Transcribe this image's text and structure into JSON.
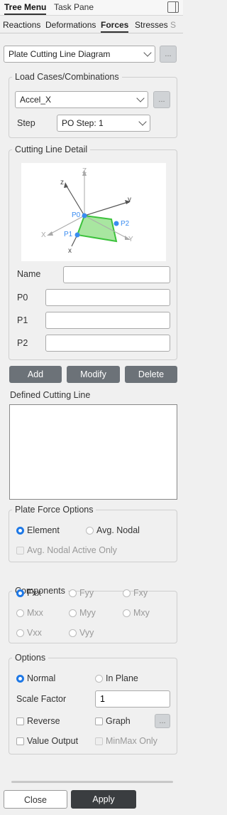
{
  "top_tabs": [
    "Tree Menu",
    "Task Pane"
  ],
  "sub_tabs": [
    "Reactions",
    "Deformations",
    "Forces",
    "Stresses",
    "S"
  ],
  "diagram_select": "Plate Cutting Line Diagram",
  "dots_label": "...",
  "load_cases": {
    "legend": "Load Cases/Combinations",
    "selected": "Accel_X",
    "step_label": "Step",
    "step_value": "PO Step: 1"
  },
  "cutting_line": {
    "legend": "Cutting Line Detail",
    "figure_labels": {
      "Z": "Z",
      "z": "z",
      "y": "y",
      "X": "X",
      "x": "x",
      "Y": "Y",
      "P0": "P0",
      "P1": "P1",
      "P2": "P2"
    },
    "name_label": "Name",
    "p0_label": "P0",
    "p1_label": "P1",
    "p2_label": "P2",
    "name_value": "",
    "p0_value": "",
    "p1_value": "",
    "p2_value": ""
  },
  "actions": {
    "add": "Add",
    "modify": "Modify",
    "delete": "Delete"
  },
  "defined_cutting_line_label": "Defined Cutting Line",
  "plate_force_options": {
    "legend": "Plate Force Options",
    "element": "Element",
    "avg_nodal": "Avg. Nodal",
    "avg_nodal_active_only": "Avg. Nodal Active Only"
  },
  "components": {
    "legend": "Components",
    "items": [
      "Fxx",
      "Fyy",
      "Fxy",
      "Mxx",
      "Myy",
      "Mxy",
      "Vxx",
      "Vyy"
    ],
    "selected": "Fxx"
  },
  "options": {
    "legend": "Options",
    "normal": "Normal",
    "in_plane": "In Plane",
    "scale_factor_label": "Scale Factor",
    "scale_factor_value": "1",
    "reverse": "Reverse",
    "graph": "Graph",
    "value_output": "Value Output",
    "minmax_only": "MinMax Only"
  },
  "footer": {
    "close": "Close",
    "apply": "Apply"
  },
  "colors": {
    "accent": "#1e78e6",
    "button": "#6c7278",
    "plate_fill": "#a8e6a0",
    "point": "#3a8cf0"
  }
}
